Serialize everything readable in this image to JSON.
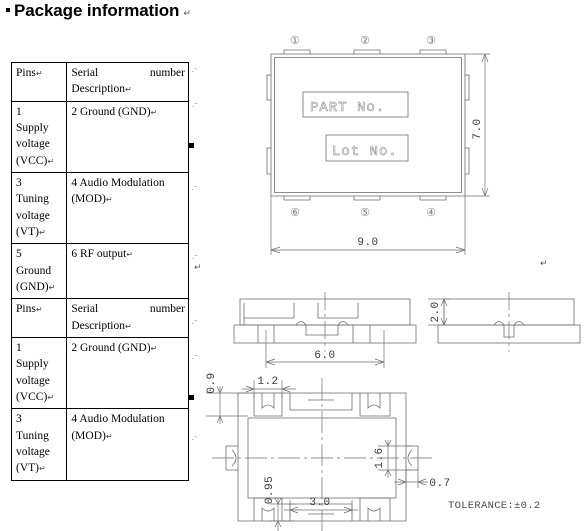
{
  "heading": {
    "bullet_icon": "square-bullet-icon",
    "title": "Package information",
    "cr_mark": "↵"
  },
  "table": {
    "cr": "↵",
    "tick": ".⁻",
    "blocks": [
      {
        "rows": [
          {
            "col1": "Pins",
            "col1_cr": true,
            "col2_line1": "Serial",
            "col2_line1b": "number",
            "col2_line2": "Description",
            "col2_cr": true,
            "justify": true
          },
          {
            "col1": "1\nSupply\nvoltage\n(VCC)",
            "col1_cr": true,
            "col2_line1": "2 Ground (GND)",
            "col2_cr": true,
            "justify": false
          },
          {
            "col1": "3\nTuning\nvoltage\n(VT)",
            "col1_cr": true,
            "col2_line1": "4  Audio  Modulation",
            "col2_line2": "(MOD)",
            "col2_cr": true,
            "justify": true
          },
          {
            "col1": "5\nGround\n(GND)",
            "col1_cr": true,
            "col2_line1": "6 RF output",
            "col2_cr": true,
            "justify": false
          }
        ]
      },
      {
        "rows": [
          {
            "col1": "Pins",
            "col1_cr": true,
            "col2_line1": "Serial",
            "col2_line1b": "number",
            "col2_line2": "Description",
            "col2_cr": true,
            "justify": true
          },
          {
            "col1": "1\nSupply\nvoltage\n(VCC)",
            "col1_cr": true,
            "col2_line1": "2 Ground (GND)",
            "col2_cr": true,
            "justify": false
          },
          {
            "col1": "3\nTuning\nvoltage\n(VT)",
            "col1_cr": true,
            "col2_line1": "4  Audio  Modulation",
            "col2_line2": "(MOD)",
            "col2_cr": true,
            "justify": true
          }
        ]
      }
    ]
  },
  "drawing": {
    "top_view": {
      "pins_top": [
        "①",
        "②",
        "③"
      ],
      "pins_bottom": [
        "⑥",
        "⑤",
        "④"
      ],
      "mark_box_1": "PART No.",
      "mark_box_2": "Lot No.",
      "dim_width": "9.0",
      "dim_height": "7.0"
    },
    "side_view_front": {
      "dim_pitch": "6.0"
    },
    "side_view_right": {
      "dim_height": "2.0"
    },
    "bottom_view": {
      "dim_pad_width": "1.2",
      "dim_edge_offset": "0.9",
      "dim_pad_gap": "0.95",
      "dim_center_pad": "3.0",
      "dim_side_pad_h": "1.6",
      "dim_side_pad_w": "0.7"
    },
    "tolerance": "TOLERANCE:±0.2",
    "cr_mark": "↵"
  },
  "colors": {
    "line": "#6f6f6f",
    "text": "#000000",
    "dim_text": "#3a3a3a"
  }
}
